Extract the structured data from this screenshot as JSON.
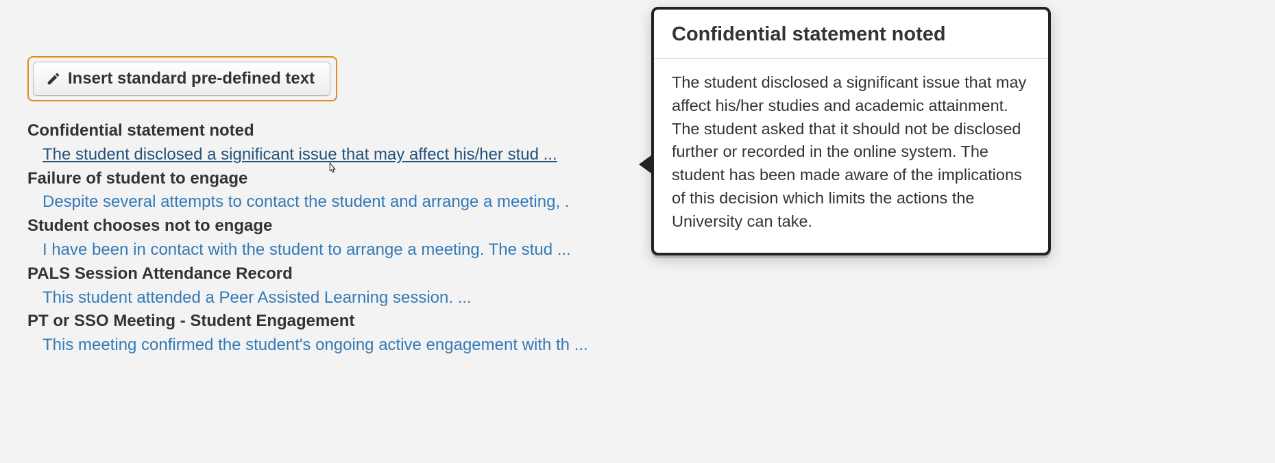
{
  "button": {
    "label": "Insert standard pre-defined text"
  },
  "items": [
    {
      "title": "Confidential statement noted",
      "preview": "The student disclosed a significant issue that may affect his/her stud ...",
      "hovered": true
    },
    {
      "title": "Failure of student to engage",
      "preview": "Despite several attempts to contact the student and arrange a meeting, .",
      "hovered": false
    },
    {
      "title": "Student chooses not to engage",
      "preview": "I have been in contact with the student to arrange a meeting. The stud ...",
      "hovered": false
    },
    {
      "title": "PALS Session Attendance Record",
      "preview": "This student attended a Peer Assisted Learning session. ...",
      "hovered": false
    },
    {
      "title": "PT or SSO Meeting - Student Engagement",
      "preview": "This meeting confirmed the student's ongoing active engagement with th ...",
      "hovered": false
    }
  ],
  "tooltip": {
    "title": "Confidential statement noted",
    "body": "The student disclosed a significant issue that may affect his/her studies and academic attainment. The student asked that it should not be disclosed further or recorded in the online system. The student has been made aware of the implications of this decision which limits the actions the University can take."
  }
}
